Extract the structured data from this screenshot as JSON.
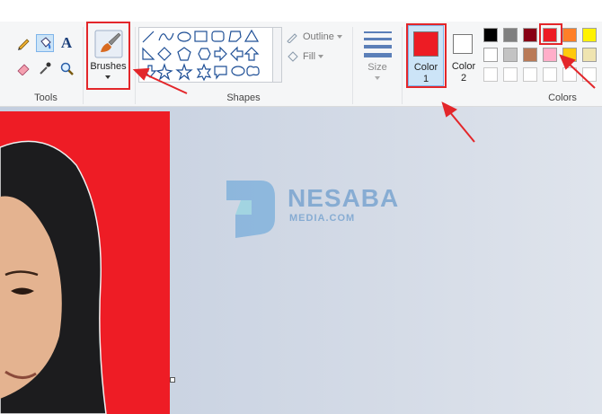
{
  "groups": {
    "tools_label": "Tools",
    "shapes_label": "Shapes",
    "colors_label": "Colors"
  },
  "brushes": {
    "label": "Brushes"
  },
  "shape_options": {
    "outline_label": "Outline",
    "fill_label": "Fill"
  },
  "size": {
    "label": "Size"
  },
  "color1": {
    "label_line1": "Color",
    "label_line2": "1",
    "value": "#ed1c24"
  },
  "color2": {
    "label_line1": "Color",
    "label_line2": "2",
    "value": "#ffffff"
  },
  "palette": [
    [
      "#000000",
      "#7f7f7f",
      "#880015",
      "#ed1c24",
      "#ff7f27",
      "#fff200"
    ],
    [
      "#ffffff",
      "#c3c3c3",
      "#b97a57",
      "#ffaec9",
      "#ffc90e",
      "#efe4b0"
    ],
    [
      "#ffffff",
      "#ffffff",
      "#ffffff",
      "#ffffff",
      "#ffffff",
      "#ffffff"
    ]
  ],
  "watermark": {
    "brand": "NESABA",
    "sub": "MEDIA.COM"
  },
  "colors": {
    "accent_red": "#e3262a",
    "canvas_red": "#ee1c25"
  }
}
